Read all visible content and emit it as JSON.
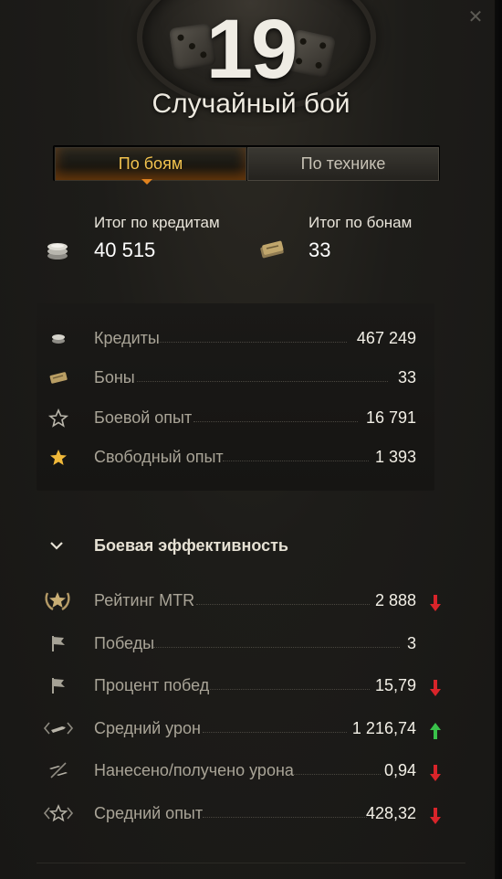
{
  "header": {
    "battle_count": "19",
    "mode_title": "Случайный бой",
    "close_icon": "close-icon"
  },
  "tabs": [
    {
      "label": "По боям",
      "active": true
    },
    {
      "label": "По технике",
      "active": false
    }
  ],
  "totals": {
    "credits": {
      "label": "Итог по кредитам",
      "value": "40 515",
      "icon": "credits-coins-icon"
    },
    "bonds": {
      "label": "Итог по бонам",
      "value": "33",
      "icon": "bonds-icon"
    }
  },
  "resources": [
    {
      "label": "Кредиты",
      "value": "467 249",
      "icon": "credits-coins-icon"
    },
    {
      "label": "Боны",
      "value": "33",
      "icon": "bonds-icon"
    },
    {
      "label": "Боевой опыт",
      "value": "16 791",
      "icon": "star-outline-icon"
    },
    {
      "label": "Свободный опыт",
      "value": "1 393",
      "icon": "star-gold-icon"
    }
  ],
  "efficiency": {
    "title": "Боевая эффективность",
    "rows": [
      {
        "label": "Рейтинг MTR",
        "value": "2 888",
        "trend": "down",
        "icon": "rating-laurel-icon"
      },
      {
        "label": "Победы",
        "value": "3",
        "trend": "none",
        "icon": "victory-flag-icon"
      },
      {
        "label": "Процент побед",
        "value": "15,79",
        "trend": "down",
        "icon": "victory-flag-icon"
      },
      {
        "label": "Средний урон",
        "value": "1 216,74",
        "trend": "up",
        "icon": "damage-shell-icon"
      },
      {
        "label": "Нанесено/получено урона",
        "value": "0,94",
        "trend": "down",
        "icon": "damage-ratio-icon"
      },
      {
        "label": "Средний опыт",
        "value": "428,32",
        "trend": "down",
        "icon": "experience-star-icon"
      }
    ]
  },
  "colors": {
    "accent_orange": "#f3c34e",
    "trend_down": "#d8242a",
    "trend_up": "#39c14a",
    "background": "#1b1a17"
  }
}
